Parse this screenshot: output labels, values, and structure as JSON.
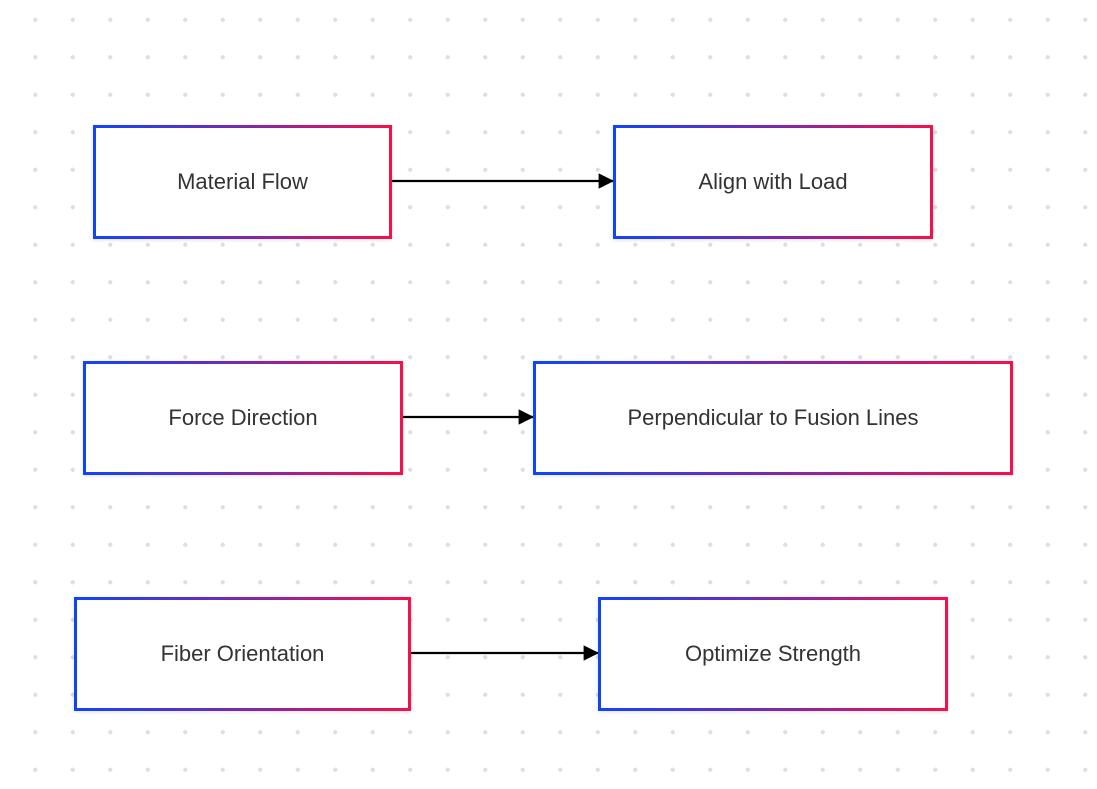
{
  "colors": {
    "gradient_start": "#1144f7",
    "gradient_end": "#f5104c",
    "arrow": "#000000",
    "dot": "#dedede"
  },
  "nodes": [
    {
      "id": "a",
      "label": "Material Flow"
    },
    {
      "id": "b",
      "label": "Align with Load"
    },
    {
      "id": "c",
      "label": "Force Direction"
    },
    {
      "id": "d",
      "label": "Perpendicular to Fusion Lines"
    },
    {
      "id": "e",
      "label": "Fiber Orientation"
    },
    {
      "id": "f",
      "label": "Optimize Strength"
    }
  ],
  "edges": [
    {
      "from": "a",
      "to": "b"
    },
    {
      "from": "c",
      "to": "d"
    },
    {
      "from": "e",
      "to": "f"
    }
  ]
}
